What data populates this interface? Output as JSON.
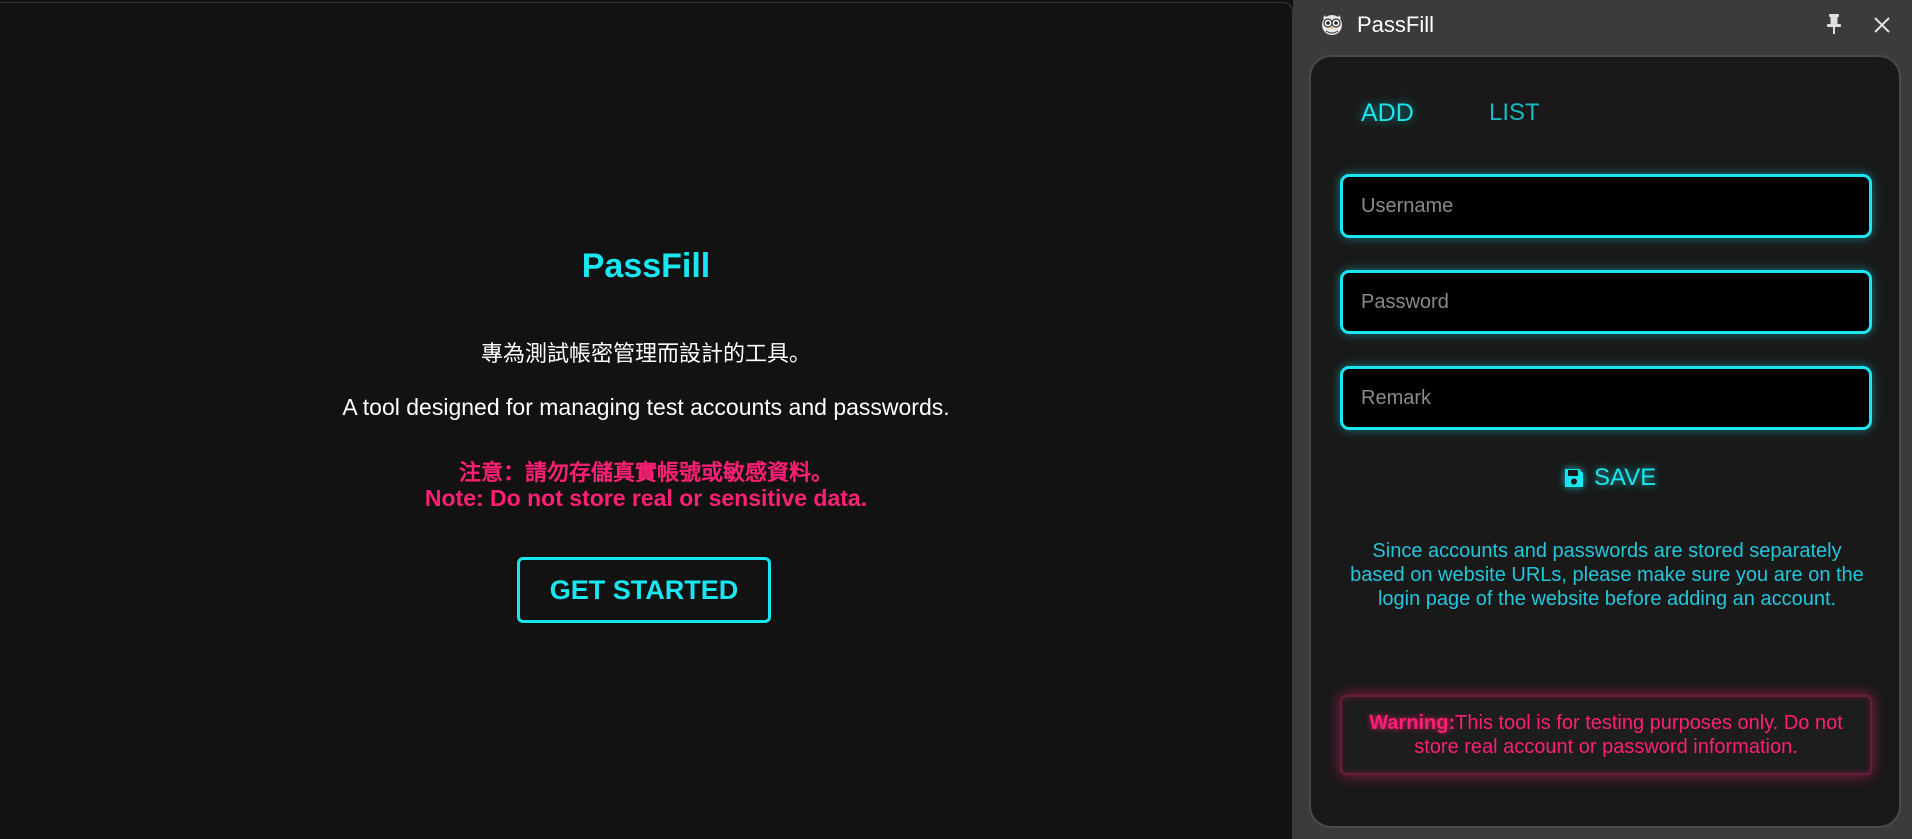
{
  "main": {
    "title": "PassFill",
    "subtitle_zh": "專為測試帳密管理而設計的工具。",
    "subtitle_en": "A tool designed for managing test accounts and passwords.",
    "note_zh": "注意：請勿存儲真實帳號或敏感資料。",
    "note_en": "Note: Do not store real or sensitive data.",
    "get_started_label": "GET STARTED"
  },
  "panel": {
    "title": "PassFill",
    "icons": {
      "app": "owl-logo-icon",
      "pin": "pin-icon",
      "close": "close-icon",
      "save": "floppy-disk-icon"
    },
    "tabs": [
      {
        "label": "ADD",
        "active": true
      },
      {
        "label": "LIST",
        "active": false
      }
    ],
    "form": {
      "username_placeholder": "Username",
      "password_placeholder": "Password",
      "remark_placeholder": "Remark",
      "username_value": "",
      "password_value": "",
      "remark_value": ""
    },
    "save_label": "SAVE",
    "info_text": "Since accounts and passwords are stored separately based on website URLs, please make sure you are on the login page of the website before adding an account.",
    "warning_label": "Warning:",
    "warning_text": "This tool is for testing purposes only. Do not store real account or password information."
  },
  "colors": {
    "accent": "#18e6f0",
    "danger": "#ff1f74",
    "background": "#121212",
    "panel": "#3b3b3b"
  }
}
